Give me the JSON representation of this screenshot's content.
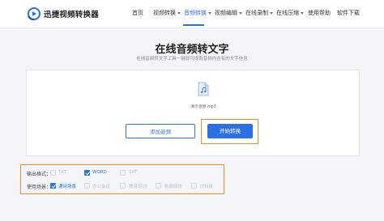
{
  "header": {
    "brand": "迅捷视频转换器",
    "nav": [
      {
        "label": "首页",
        "dropdown": false,
        "active": false
      },
      {
        "label": "视频转换",
        "dropdown": true,
        "active": false
      },
      {
        "label": "音频转换",
        "dropdown": true,
        "active": true
      },
      {
        "label": "视频编辑",
        "dropdown": true,
        "active": false
      },
      {
        "label": "在线录制",
        "dropdown": true,
        "active": false
      },
      {
        "label": "在线压缩",
        "dropdown": true,
        "active": false
      },
      {
        "label": "使用帮助",
        "dropdown": false,
        "active": false
      },
      {
        "label": "软件下载",
        "dropdown": false,
        "active": false
      }
    ],
    "accent_color": "#2c70e6"
  },
  "main": {
    "title": "在线音频转文字",
    "subtitle": "在线音频转文字工具一键即可提取音频内含有的文字信息",
    "file": {
      "icon": "audio-file-icon",
      "name": "演示音频.mp3"
    },
    "add_button": "添加音频",
    "start_button": "开始转换",
    "highlight_color": "#f08a2a"
  },
  "options": {
    "output_format": {
      "label": "输出格式：",
      "choices": [
        {
          "text": "TXT",
          "checked": false,
          "enabled": false
        },
        {
          "text": "WORD",
          "checked": true,
          "enabled": true
        },
        {
          "text": "SRT",
          "checked": false,
          "enabled": false
        }
      ]
    },
    "scene": {
      "label": "使用场景：",
      "choices": [
        {
          "text": "通用场景",
          "checked": true,
          "enabled": true
        },
        {
          "text": "办公会议",
          "checked": false,
          "enabled": false
        },
        {
          "text": "教育培训",
          "checked": false,
          "enabled": false
        },
        {
          "text": "新闻媒体",
          "checked": false,
          "enabled": false
        },
        {
          "text": "IT科技",
          "checked": false,
          "enabled": false
        }
      ]
    }
  }
}
